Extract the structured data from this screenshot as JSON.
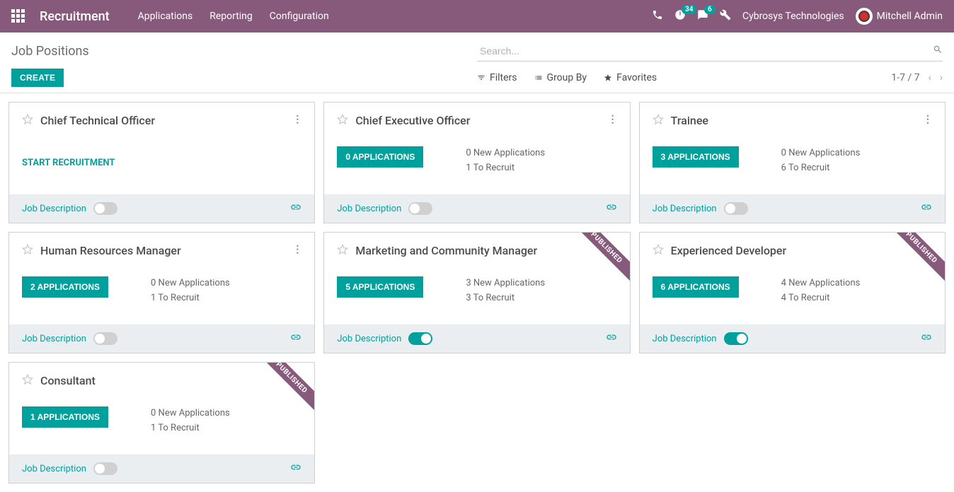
{
  "navbar": {
    "brand": "Recruitment",
    "menu": [
      "Applications",
      "Reporting",
      "Configuration"
    ],
    "activity_count": "34",
    "message_count": "6",
    "company": "Cybrosys Technologies",
    "user": "Mitchell Admin"
  },
  "control": {
    "breadcrumb": "Job Positions",
    "create_label": "CREATE",
    "search_placeholder": "Search...",
    "filters_label": "Filters",
    "groupby_label": "Group By",
    "favorites_label": "Favorites",
    "pager": "1-7 / 7"
  },
  "labels": {
    "job_description": "Job Description",
    "start_recruitment": "START RECRUITMENT",
    "published": "PUBLISHED"
  },
  "cards": [
    {
      "title": "Chief Technical Officer",
      "mode": "start",
      "toggle_on": false,
      "published": false
    },
    {
      "title": "Chief Executive Officer",
      "apps_label": "0 APPLICATIONS",
      "new_apps": "0 New Applications",
      "to_recruit": "1 To Recruit",
      "toggle_on": false,
      "published": false
    },
    {
      "title": "Trainee",
      "apps_label": "3 APPLICATIONS",
      "new_apps": "0 New Applications",
      "to_recruit": "6 To Recruit",
      "toggle_on": false,
      "published": false
    },
    {
      "title": "Human Resources Manager",
      "apps_label": "2 APPLICATIONS",
      "new_apps": "0 New Applications",
      "to_recruit": "1 To Recruit",
      "toggle_on": false,
      "published": false
    },
    {
      "title": "Marketing and Community Manager",
      "apps_label": "5 APPLICATIONS",
      "new_apps": "3 New Applications",
      "to_recruit": "3 To Recruit",
      "toggle_on": true,
      "published": true
    },
    {
      "title": "Experienced Developer",
      "apps_label": "6 APPLICATIONS",
      "new_apps": "4 New Applications",
      "to_recruit": "4 To Recruit",
      "toggle_on": true,
      "published": true
    },
    {
      "title": "Consultant",
      "apps_label": "1 APPLICATIONS",
      "new_apps": "0 New Applications",
      "to_recruit": "1 To Recruit",
      "toggle_on": false,
      "published": true
    }
  ]
}
